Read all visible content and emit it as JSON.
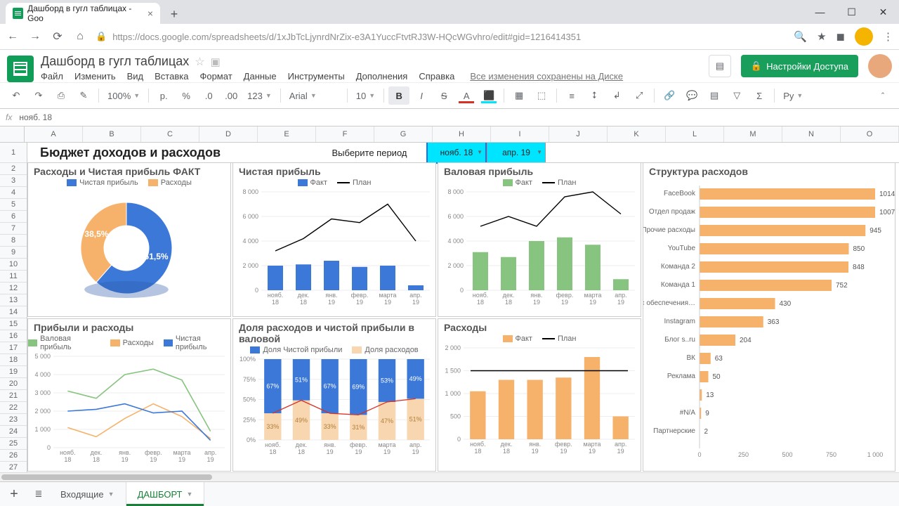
{
  "browser": {
    "tab_title": "Дашборд в гугл таблицах - Goo",
    "url": "https://docs.google.com/spreadsheets/d/1xJbTcLjynrdNrZix-e3A1YuccFtvtRJ3W-HQcWGvhro/edit#gid=1216414351"
  },
  "doc": {
    "title": "Дашборд в гугл таблицах",
    "menus": [
      "Файл",
      "Изменить",
      "Вид",
      "Вставка",
      "Формат",
      "Данные",
      "Инструменты",
      "Дополнения",
      "Справка"
    ],
    "saved": "Все изменения сохранены на Диске",
    "share": "Настройки Доступа"
  },
  "toolbar": {
    "zoom": "100%",
    "currency": "р.",
    "pct": "%",
    "dec0": ".0",
    "dec00": ".00",
    "numfmt": "123",
    "font": "Arial",
    "size": "10",
    "end": "Ру"
  },
  "fx": {
    "cell": "нояб. 18"
  },
  "columns": [
    "A",
    "B",
    "C",
    "D",
    "E",
    "F",
    "G",
    "H",
    "I",
    "J",
    "K",
    "L",
    "M",
    "N",
    "O"
  ],
  "dash": {
    "main_title": "Бюджет доходов и расходов",
    "period_label": "Выберите период",
    "period_from": "нояб. 18",
    "period_to": "апр. 19"
  },
  "footer": {
    "tab1": "Входящие",
    "tab2": "ДАШБОРТ"
  },
  "chart_data": [
    {
      "id": "donut",
      "type": "pie",
      "title": "Расходы и Чистая прибыль ФАКТ",
      "series": [
        {
          "name": "Чистая прибыль",
          "value": 61.5,
          "color": "#3b78d8"
        },
        {
          "name": "Расходы",
          "value": 38.5,
          "color": "#f6b26b"
        }
      ],
      "labels": [
        "61,5%",
        "38,5%"
      ]
    },
    {
      "id": "net_profit",
      "type": "bar",
      "title": "Чистая прибыль",
      "legend": [
        {
          "name": "Факт",
          "color": "#3b78d8"
        },
        {
          "name": "План",
          "color": "#000"
        }
      ],
      "categories": [
        "нояб. 18",
        "дек. 18",
        "янв. 19",
        "февр. 19",
        "марта 19",
        "апр. 19"
      ],
      "values": [
        2000,
        2100,
        2400,
        1900,
        2000,
        400
      ],
      "plan": [
        3200,
        4200,
        5800,
        5500,
        7000,
        4000
      ],
      "ylim": [
        0,
        8000
      ],
      "yticks": [
        0,
        2000,
        4000,
        6000,
        8000
      ]
    },
    {
      "id": "gross_profit",
      "type": "bar",
      "title": "Валовая прибыль",
      "legend": [
        {
          "name": "Факт",
          "color": "#87c47f"
        },
        {
          "name": "План",
          "color": "#000"
        }
      ],
      "categories": [
        "нояб. 18",
        "дек. 18",
        "янв. 19",
        "февр. 19",
        "марта 19",
        "апр. 19"
      ],
      "values": [
        3100,
        2700,
        4000,
        4300,
        3700,
        900
      ],
      "plan": [
        5200,
        6000,
        5200,
        7600,
        8000,
        6200
      ],
      "ylim": [
        0,
        8000
      ],
      "yticks": [
        0,
        2000,
        4000,
        6000,
        8000
      ]
    },
    {
      "id": "expense_structure",
      "type": "bar",
      "orientation": "horizontal",
      "title": "Структура расходов",
      "categories": [
        "FaceBook",
        "Отдел продаж",
        "Прочие расходы",
        "YouTube",
        "Команда 2",
        "Команда 1",
        "Сервис обеспечения…",
        "Instagram",
        "Блог s..ru",
        "ВК",
        "Реклама",
        "",
        "#N/A",
        "Партнерские"
      ],
      "values": [
        1014,
        1007,
        945,
        850,
        848,
        752,
        430,
        363,
        204,
        63,
        50,
        13,
        9,
        2
      ],
      "color": "#f6b26b",
      "xlim": [
        0,
        1000
      ],
      "xticks": [
        0,
        250,
        500,
        750,
        1000
      ]
    },
    {
      "id": "profits_expenses",
      "type": "line",
      "title": "Прибыли и расходы",
      "legend": [
        {
          "name": "Валовая прибыль",
          "color": "#87c47f"
        },
        {
          "name": "Расходы",
          "color": "#f6b26b"
        },
        {
          "name": "Чистая прибыль",
          "color": "#3b78d8"
        }
      ],
      "categories": [
        "нояб. 18",
        "дек. 18",
        "янв. 19",
        "февр. 19",
        "марта 19",
        "апр. 19"
      ],
      "series": [
        {
          "name": "Валовая прибыль",
          "color": "#87c47f",
          "values": [
            3100,
            2700,
            4000,
            4300,
            3700,
            900
          ]
        },
        {
          "name": "Расходы",
          "color": "#f6b26b",
          "values": [
            1100,
            600,
            1600,
            2400,
            1700,
            500
          ]
        },
        {
          "name": "Чистая прибыль",
          "color": "#3b78d8",
          "values": [
            2000,
            2100,
            2400,
            1900,
            2000,
            400
          ]
        }
      ],
      "ylim": [
        0,
        5000
      ],
      "yticks": [
        0,
        1000,
        2000,
        3000,
        4000,
        5000
      ]
    },
    {
      "id": "share_in_gross",
      "type": "bar",
      "stacked": true,
      "title": "Доля расходов и чистой прибыли в валовой",
      "legend": [
        {
          "name": "Доля Чистой прибыли",
          "color": "#3b78d8"
        },
        {
          "name": "Доля расходов",
          "color": "#f8d7b0"
        }
      ],
      "categories": [
        "нояб. 18",
        "дек. 18",
        "янв. 19",
        "февр. 19",
        "марта 19",
        "апр. 19"
      ],
      "net_share": [
        67,
        51,
        67,
        69,
        53,
        49
      ],
      "exp_share": [
        33,
        49,
        33,
        31,
        47,
        51
      ],
      "ylim": [
        0,
        100
      ],
      "yticks": [
        0,
        25,
        50,
        75,
        100
      ]
    },
    {
      "id": "expenses",
      "type": "bar",
      "title": "Расходы",
      "legend": [
        {
          "name": "Факт",
          "color": "#f6b26b"
        },
        {
          "name": "План",
          "color": "#000"
        }
      ],
      "categories": [
        "нояб. 18",
        "дек. 18",
        "янв. 19",
        "февр. 19",
        "марта 19",
        "апр. 19"
      ],
      "values": [
        1050,
        1300,
        1300,
        1350,
        1800,
        500
      ],
      "plan_level": 1500,
      "ylim": [
        0,
        2000
      ],
      "yticks": [
        0,
        500,
        1000,
        1500,
        2000
      ]
    }
  ]
}
